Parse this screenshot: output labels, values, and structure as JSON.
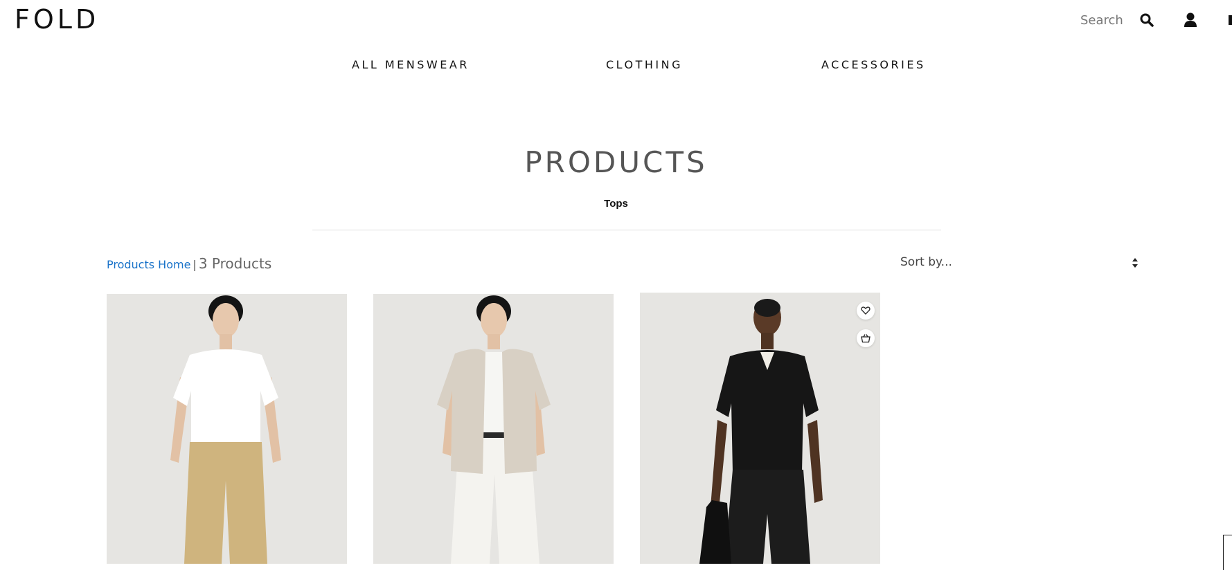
{
  "header": {
    "logo": "FOLD",
    "search_label": "Search",
    "icons": [
      "search-icon",
      "user-icon",
      "cart-icon"
    ]
  },
  "nav": {
    "items": [
      {
        "label": "ALL MENSWEAR"
      },
      {
        "label": "CLOTHING"
      },
      {
        "label": "ACCESSORIES"
      }
    ]
  },
  "page": {
    "title": "PRODUCTS",
    "subcategory": "Tops"
  },
  "listing": {
    "breadcrumb_home": "Products Home",
    "separator": "|",
    "count_label": "3 Products",
    "sort_label": "Sort by..."
  },
  "products": [
    {
      "image": "model-white-tshirt-beige-trousers",
      "top_color": "#ffffff",
      "bottom_color": "#cfb47e"
    },
    {
      "image": "model-linen-shirt-white-trousers",
      "top_color": "#d8d0c4",
      "bottom_color": "#f4f3ef"
    },
    {
      "image": "model-black-polo-black-trousers",
      "top_color": "#161616",
      "bottom_color": "#1c1c1c",
      "actions": [
        "heart-icon",
        "basket-icon"
      ]
    }
  ],
  "colors": {
    "accent_link": "#1a73c9",
    "image_background": "#e6e5e2",
    "title": "#555555"
  }
}
